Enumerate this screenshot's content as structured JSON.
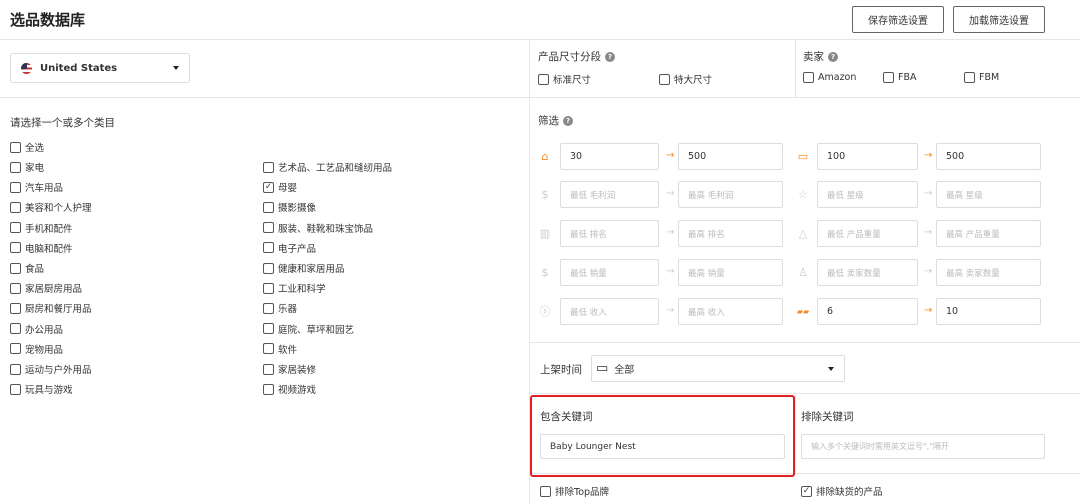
{
  "page": {
    "title": "选品数据库"
  },
  "toolbar": {
    "save_label": "保存筛选设置",
    "load_label": "加载筛选设置"
  },
  "country": {
    "value": "United States"
  },
  "size_segment": {
    "label": "产品尺寸分段",
    "options": [
      "标准尺寸",
      "特大尺寸"
    ]
  },
  "seller": {
    "label": "卖家",
    "options": [
      "Amazon",
      "FBA",
      "FBM"
    ]
  },
  "categories": {
    "heading": "请选择一个或多个类目",
    "select_all": "全选",
    "left": [
      "家电",
      "汽车用品",
      "美容和个人护理",
      "手机和配件",
      "电脑和配件",
      "食品",
      "家居厨房用品",
      "厨房和餐厅用品",
      "办公用品",
      "宠物用品",
      "运动与户外用品",
      "玩具与游戏"
    ],
    "right": [
      "艺术品、工艺品和缝纫用品",
      "母婴",
      "摄影摄像",
      "服装、鞋靴和珠宝饰品",
      "电子产品",
      "健康和家居用品",
      "工业和科学",
      "乐器",
      "庭院、草坪和园艺",
      "软件",
      "家居装修",
      "视频游戏"
    ],
    "checked_right_index": 1
  },
  "filters": {
    "label": "筛选",
    "price": {
      "min": "30",
      "max": "500"
    },
    "reviews": {
      "min": "100",
      "max": "500"
    },
    "profit": {
      "min_placeholder": "最低 毛利润",
      "max_placeholder": "最高 毛利润"
    },
    "rating": {
      "min_placeholder": "最低 星级",
      "max_placeholder": "最高 星级"
    },
    "rank": {
      "min_placeholder": "最低 排名",
      "max_placeholder": "最高 排名"
    },
    "weight": {
      "min_placeholder": "最低 产品重量",
      "max_placeholder": "最高 产品重量"
    },
    "sales": {
      "min_placeholder": "最低 销量",
      "max_placeholder": "最高 销量"
    },
    "sellers_count": {
      "min_placeholder": "最低 卖家数量",
      "max_placeholder": "最高 卖家数量"
    },
    "revenue": {
      "min_placeholder": "最低 收入",
      "max_placeholder": "最高 收入"
    },
    "other": {
      "min": "6",
      "max": "10"
    }
  },
  "listing_time": {
    "label": "上架时间",
    "value": "全部"
  },
  "include_keywords": {
    "label": "包含关键词",
    "value": "Baby Lounger Nest"
  },
  "exclude_keywords": {
    "label": "排除关键词",
    "placeholder": "输入多个关键词时需用英文逗号\",\"隔开"
  },
  "bottom": {
    "exclude_top_brand": "排除Top品牌",
    "exclude_oos": "排除缺货的产品"
  }
}
